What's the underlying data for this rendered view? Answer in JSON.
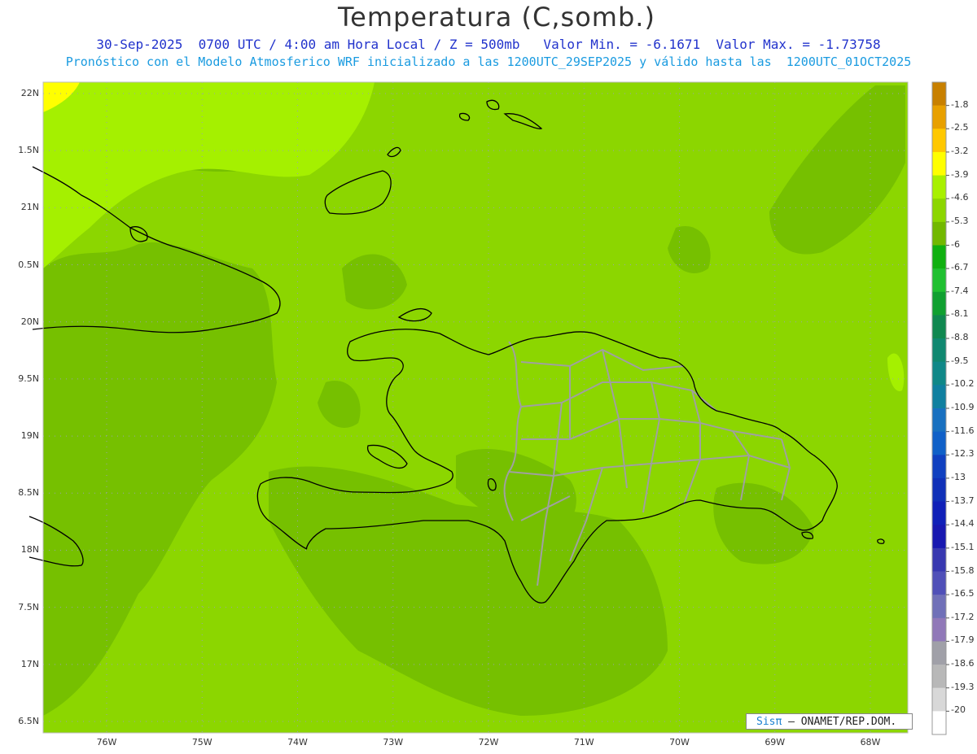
{
  "header": {
    "title": "Temperatura (C,somb.)",
    "subtitle": "30-Sep-2025  0700 UTC / 4:00 am Hora Local / Z = 500mb   Valor Min. = -6.1671  Valor Max. = -1.73758",
    "forecast_note": "Pronóstico con el Modelo Atmosferico WRF inicializado a las 1200UTC_29SEP2025 y válido hasta las  1200UTC_01OCT2025"
  },
  "map": {
    "lat_labels": [
      "22N",
      "1.5N",
      "21N",
      "0.5N",
      "20N",
      "9.5N",
      "19N",
      "8.5N",
      "18N",
      "7.5N",
      "17N",
      "6.5N"
    ],
    "lon_labels": [
      "76W",
      "75W",
      "74W",
      "73W",
      "72W",
      "71W",
      "70W",
      "69W",
      "68W"
    ],
    "colors": {
      "base_field": "#8cd600",
      "darker_field": "#76c000",
      "lighter_field": "#a5f000",
      "coastline": "#000000",
      "provinces": "#a0a0a0",
      "gridline": "#9aa0b0"
    }
  },
  "colorbar": {
    "labels": [
      "-1.8",
      "-2.5",
      "-3.2",
      "-3.9",
      "-4.6",
      "-5.3",
      "-6",
      "-6.7",
      "-7.4",
      "-8.1",
      "-8.8",
      "-9.5",
      "-10.2",
      "-10.9",
      "-11.6",
      "-12.3",
      "-13",
      "-13.7",
      "-14.4",
      "-15.1",
      "-15.8",
      "-16.5",
      "-17.2",
      "-17.9",
      "-18.6",
      "-19.3",
      "-20"
    ],
    "colors": [
      "#c88000",
      "#e8a000",
      "#ffc800",
      "#ffff00",
      "#a8f000",
      "#8cd600",
      "#72b800",
      "#10b010",
      "#20c030",
      "#10a030",
      "#108850",
      "#108870",
      "#108888",
      "#1080a0",
      "#1870c0",
      "#1060c8",
      "#1040c0",
      "#1030b8",
      "#1020b8",
      "#1818b0",
      "#3838b0",
      "#5050b8",
      "#7070b8",
      "#9078b8",
      "#a0a0a8",
      "#b8b8b8",
      "#d8d8d8",
      "#ffffff"
    ]
  },
  "credit": {
    "sis": "Sisπ",
    "org": " – ONAMET/REP.DOM."
  }
}
